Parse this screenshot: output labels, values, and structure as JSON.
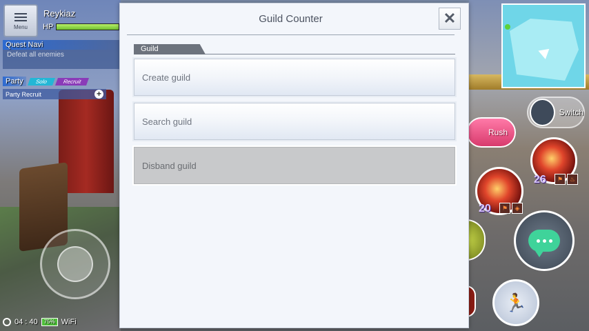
{
  "hud": {
    "menu_label": "Menu",
    "player_name": "Reykiaz",
    "hp_label": "HP",
    "hp_fraction": 0.92,
    "quest_navi_title": "Quest Navi",
    "quest_navi_text": "Defeat all enemies",
    "party_label": "Party",
    "party_tabs": [
      "Solo",
      "Recruit"
    ],
    "party_recruit_label": "Party Recruit",
    "clock": "04 : 40",
    "battery": "75%",
    "network": "WiFi"
  },
  "right_hud": {
    "switch_label": "Switch",
    "rush_label": "Rush",
    "skill_counts": [
      "26",
      "20"
    ]
  },
  "dialog": {
    "title": "Guild Counter",
    "close_glyph": "✕",
    "section_label": "Guild",
    "buttons": [
      {
        "label": "Create guild",
        "enabled": true
      },
      {
        "label": "Search guild",
        "enabled": true
      },
      {
        "label": "Disband guild",
        "enabled": false
      }
    ]
  },
  "icons": {
    "menu": "hamburger-icon",
    "close": "close-icon",
    "add": "plus-icon",
    "chat": "chat-bubble-icon",
    "dash": "dash-runner-icon",
    "minimap_player": "player-arrow-icon"
  },
  "colors": {
    "dialog_bg": "#f3f6fb",
    "section_tab": "#6d737d",
    "disabled_button": "#c8c9cb",
    "hp_fill": "#6fbf2f",
    "minimap": "#6fd6e8"
  }
}
